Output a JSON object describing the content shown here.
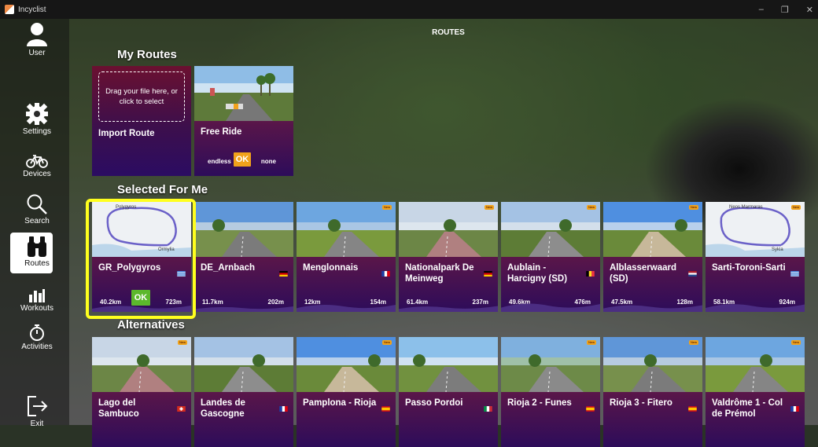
{
  "window": {
    "title": "Incyclist",
    "controls": [
      "–",
      "❐",
      "✕"
    ]
  },
  "sidebar": {
    "items": [
      {
        "id": "user",
        "label": "User"
      },
      {
        "id": "settings",
        "label": "Settings"
      },
      {
        "id": "devices",
        "label": "Devices"
      },
      {
        "id": "search",
        "label": "Search"
      },
      {
        "id": "routes",
        "label": "Routes"
      },
      {
        "id": "workouts",
        "label": "Workouts"
      },
      {
        "id": "activities",
        "label": "Activities"
      },
      {
        "id": "exit",
        "label": "Exit"
      }
    ]
  },
  "page": {
    "title": "ROUTES"
  },
  "sections": {
    "my_routes": "My Routes",
    "selected": "Selected For Me",
    "alternatives": "Alternatives"
  },
  "my_routes": {
    "import": {
      "drop_text": "Drag your file here, or click to select",
      "name": "Import Route"
    },
    "free_ride": {
      "name": "Free Ride",
      "distance": "endless",
      "ok": "OK",
      "elevation": "none"
    }
  },
  "selected": [
    {
      "name": "GR_Polygyros",
      "distance": "40.2km",
      "elevation": "723m",
      "ok": "OK",
      "flag": "greece",
      "map": true,
      "map_labels": [
        "Polygyros",
        "Ormylia"
      ],
      "new": false
    },
    {
      "name": "DE_Arnbach",
      "distance": "11.7km",
      "elevation": "202m",
      "flag": "germany",
      "new": false
    },
    {
      "name": "Menglonnais",
      "distance": "12km",
      "elevation": "154m",
      "flag": "france",
      "new": true
    },
    {
      "name": "Nationalpark De Meinweg",
      "distance": "61.4km",
      "elevation": "237m",
      "flag": "germany",
      "new": true
    },
    {
      "name": "Aublain - Harcigny (SD)",
      "distance": "49.6km",
      "elevation": "476m",
      "flag": "belgium",
      "new": true
    },
    {
      "name": "Alblasserwaard (SD)",
      "distance": "47.5km",
      "elevation": "128m",
      "flag": "netherlands",
      "new": true
    },
    {
      "name": "Sarti-Toroni-Sarti",
      "distance": "58.1km",
      "elevation": "924m",
      "flag": "greece",
      "map": true,
      "map_labels": [
        "Neos Marmaras",
        "Sykia"
      ],
      "new": true
    }
  ],
  "alternatives": [
    {
      "name": "Lago del Sambuco",
      "flag": "switzerland",
      "new": true
    },
    {
      "name": "Landes de Gascogne",
      "flag": "france",
      "new": false
    },
    {
      "name": "Pamplona - Rioja",
      "flag": "spain",
      "new": true
    },
    {
      "name": "Passo Pordoi",
      "flag": "italy",
      "new": false
    },
    {
      "name": "Rioja 2 - Funes",
      "flag": "spain",
      "new": true
    },
    {
      "name": "Rioja 3 - Fitero",
      "flag": "spain",
      "new": true
    },
    {
      "name": "Valdrôme 1 - Col de Prémol",
      "flag": "france",
      "new": true
    }
  ],
  "new_badge_text": "New",
  "colors": {
    "accent": "#f0a21b",
    "selected_border": "#ffff1e",
    "card_info": "#3b0f5a",
    "ok_green": "#5cb82c"
  }
}
